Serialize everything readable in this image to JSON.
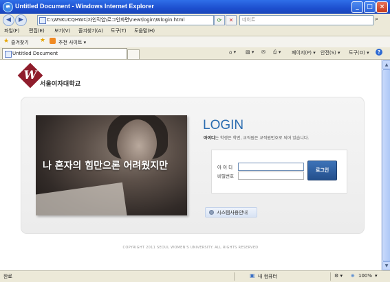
{
  "window": {
    "title": "Untitled Document - Windows Internet Explorer",
    "minimize": "_",
    "maximize": "□",
    "close": "×"
  },
  "address": {
    "url": "C:\\WSKUCQHW디자인작업\\로그인화면\\new\\login\\Wlogin.html",
    "search_placeholder": "네이트"
  },
  "menu": [
    "파일(F)",
    "편집(E)",
    "보기(V)",
    "즐겨찾기(A)",
    "도구(T)",
    "도움말(H)"
  ],
  "favorites": {
    "label": "즐겨찾기",
    "suggested": "추천 사이트 ▾"
  },
  "tab": {
    "title": "Untitled Document"
  },
  "toolbar": {
    "page": "페이지(P) ▾",
    "safety": "안전(S) ▾",
    "tools": "도구(O) ▾",
    "help": "?"
  },
  "page": {
    "logo_text": "서울여자대학교",
    "logo_letter": "W",
    "slogan": "나 혼자의 힘만으론 어려웠지만",
    "login_title": "LOGIN",
    "login_subtitle_bold": "아이디",
    "login_subtitle_rest": "는 학생은 학번, 교직원은 교직원번호로 되어 있습니다.",
    "id_label": "아 이 디",
    "pw_label": "비밀번호",
    "login_button": "로그인",
    "guide_button": "시스템사용안내",
    "copyright": "COPYRIGHT 2011 SEOUL WOMEN'S UNIVERSITY. ALL RIGHTS RESERVED"
  },
  "status": {
    "left": "완료",
    "zone": "내 컴퓨터",
    "zoom": "100%"
  }
}
